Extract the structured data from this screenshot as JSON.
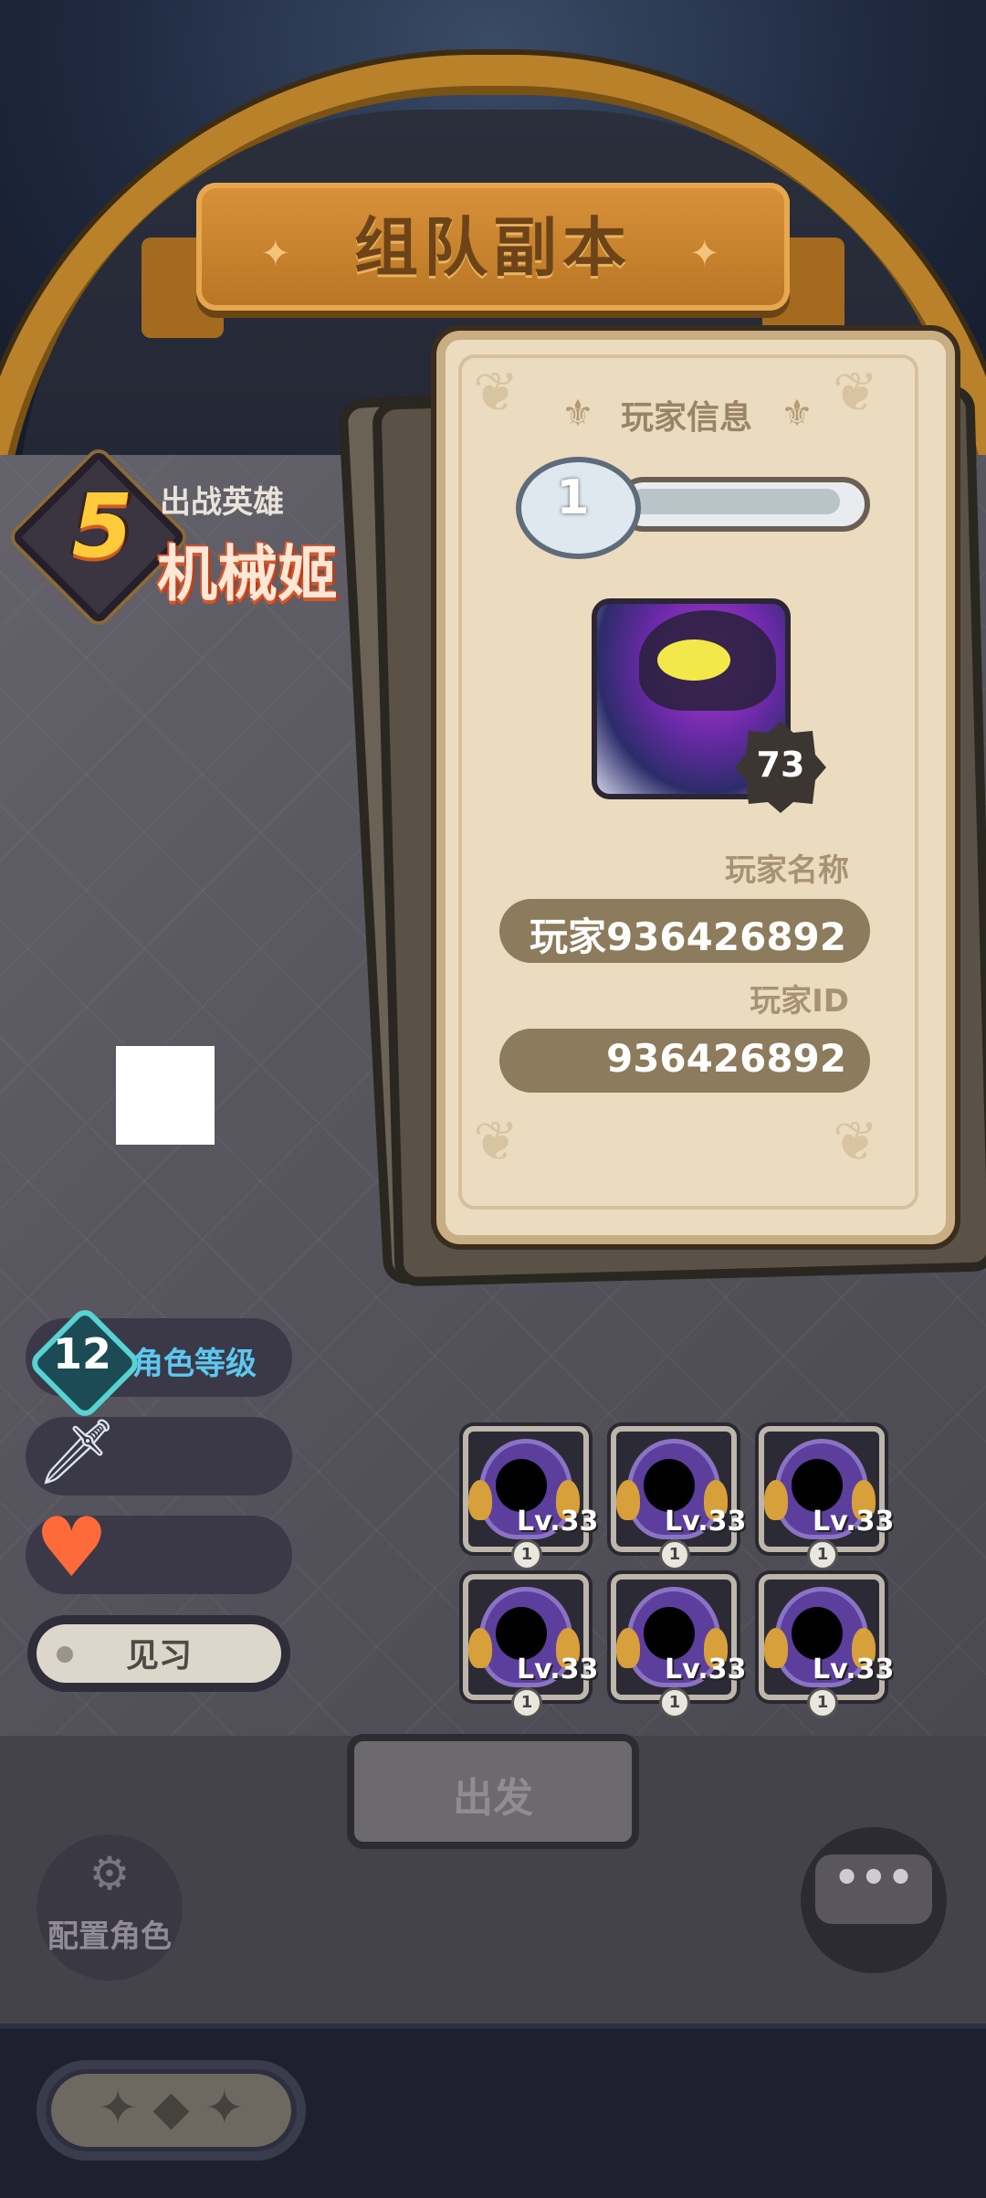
{
  "header": {
    "title": "组队副本"
  },
  "hero": {
    "rank": "5",
    "subtitle": "出战英雄",
    "name": "机械姬"
  },
  "stats": {
    "level_value": "12",
    "level_label": "角色等级",
    "status_label": "见习"
  },
  "player_card": {
    "title": "玩家信息",
    "rank_level": "1",
    "avatar_level": "73",
    "name_label": "玩家名称",
    "name_value": "玩家936426892",
    "id_label": "玩家ID",
    "id_value": "936426892"
  },
  "team_slots": [
    {
      "level": "Lv.33",
      "stars": "1"
    },
    {
      "level": "Lv.33",
      "stars": "1"
    },
    {
      "level": "Lv.33",
      "stars": "1"
    },
    {
      "level": "Lv.33",
      "stars": "1"
    },
    {
      "level": "Lv.33",
      "stars": "1"
    },
    {
      "level": "Lv.33",
      "stars": "1"
    }
  ],
  "controls": {
    "go_label": "出发",
    "config_label": "配置角色",
    "chat_icon": "chat-bubble-icon",
    "back_icon": "back-arrow-icon"
  },
  "colors": {
    "accent_gold": "#b9822a",
    "level_cyan": "#5cc8f0",
    "hero_name": "#d3572d"
  }
}
